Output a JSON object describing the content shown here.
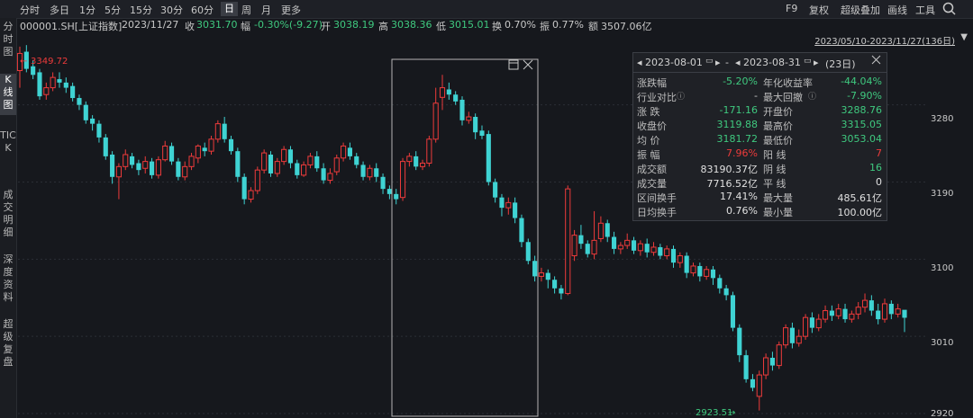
{
  "toolbar": {
    "timeframes": [
      "分时",
      "多日",
      "1分",
      "5分",
      "15分",
      "30分",
      "60分",
      "日",
      "周",
      "月",
      "更多"
    ],
    "active_timeframe": "日",
    "right": [
      "F9",
      "复权",
      "超级叠加",
      "画线",
      "工具"
    ]
  },
  "info": {
    "code": "000001.SH[上证指数]",
    "date": "2023/11/27",
    "close_label": "收",
    "close": "3031.70",
    "change_label": "幅",
    "change": "-0.30%(-9.27)",
    "open_label": "开",
    "open": "3038.19",
    "high_label": "高",
    "high": "3038.36",
    "low_label": "低",
    "low": "3015.01",
    "turnover_label": "换",
    "turnover": "0.70%",
    "amplitude_label": "振",
    "amplitude": "0.77%",
    "amount_label": "额",
    "amount": "3507.06亿"
  },
  "sidebar": {
    "tabs": [
      "分时图",
      "K线图",
      "TICK",
      "成交明细",
      "深度资料",
      "超级复盘"
    ],
    "active": "K线图"
  },
  "chart": {
    "range": "2023/05/10-2023/11/27(136日)",
    "max_label": "3349.72",
    "min_label": "2923.51",
    "y_ticks": [
      "3280",
      "3190",
      "3100",
      "3010",
      "2920"
    ]
  },
  "panel": {
    "start_date": "2023-08-01",
    "end_date": "2023-08-31",
    "days": "(23日)",
    "separator": "-",
    "rows": [
      {
        "l1": "涨跌幅",
        "v1": "-5.20%",
        "c1": "green",
        "l2": "年化收益率",
        "v2": "-44.04%",
        "c2": "green"
      },
      {
        "l1": "行业对比",
        "v1": "-",
        "c1": "gray",
        "l2": "最大回撤",
        "v2": "-7.90%",
        "c2": "green"
      },
      {
        "l1": "涨 跌",
        "v1": "-171.16",
        "c1": "green",
        "l2": "开盘价",
        "v2": "3288.76",
        "c2": "green"
      },
      {
        "l1": "收盘价",
        "v1": "3119.88",
        "c1": "green",
        "l2": "最高价",
        "v2": "3315.05",
        "c2": "green"
      },
      {
        "l1": "均 价",
        "v1": "3181.72",
        "c1": "green",
        "l2": "最低价",
        "v2": "3053.04",
        "c2": "green"
      },
      {
        "l1": "振 幅",
        "v1": "7.96%",
        "c1": "red",
        "l2": "阳 线",
        "v2": "7",
        "c2": "red"
      },
      {
        "l1": "成交额",
        "v1": "83190.37亿",
        "c1": "white",
        "l2": "阴 线",
        "v2": "16",
        "c2": "green"
      },
      {
        "l1": "成交量",
        "v1": "7716.52亿",
        "c1": "white",
        "l2": "平 线",
        "v2": "0",
        "c2": "white"
      },
      {
        "l1": "区间换手",
        "v1": "17.41%",
        "c1": "white",
        "l2": "最大量",
        "v2": "485.61亿",
        "c2": "white"
      },
      {
        "l1": "日均换手",
        "v1": "0.76%",
        "c1": "white",
        "l2": "最小量",
        "v2": "100.00亿",
        "c2": "white"
      }
    ]
  },
  "chart_data": {
    "type": "candlestick",
    "y_ticks": [
      3280,
      3190,
      3100,
      3010,
      2920
    ],
    "ylim": [
      2920,
      3352
    ],
    "max_marker": 3349.72,
    "min_marker": 2923.51,
    "candles": [
      [
        3320,
        3340,
        3300,
        3348
      ],
      [
        3342,
        3322,
        3318,
        3349.72
      ],
      [
        3325,
        3315,
        3310,
        3332
      ],
      [
        3318,
        3290,
        3286,
        3322
      ],
      [
        3292,
        3300,
        3286,
        3306
      ],
      [
        3300,
        3312,
        3296,
        3318
      ],
      [
        3310,
        3306,
        3300,
        3318
      ],
      [
        3306,
        3300,
        3294,
        3312
      ],
      [
        3302,
        3288,
        3284,
        3306
      ],
      [
        3288,
        3280,
        3274,
        3292
      ],
      [
        3280,
        3262,
        3258,
        3284
      ],
      [
        3264,
        3258,
        3250,
        3268
      ],
      [
        3258,
        3242,
        3236,
        3262
      ],
      [
        3242,
        3220,
        3216,
        3246
      ],
      [
        3222,
        3196,
        3188,
        3226
      ],
      [
        3196,
        3208,
        3170,
        3212
      ],
      [
        3208,
        3222,
        3204,
        3228
      ],
      [
        3220,
        3210,
        3206,
        3224
      ],
      [
        3212,
        3204,
        3198,
        3216
      ],
      [
        3206,
        3214,
        3200,
        3220
      ],
      [
        3214,
        3198,
        3194,
        3218
      ],
      [
        3198,
        3216,
        3194,
        3220
      ],
      [
        3216,
        3232,
        3214,
        3238
      ],
      [
        3232,
        3214,
        3210,
        3236
      ],
      [
        3214,
        3196,
        3192,
        3218
      ],
      [
        3196,
        3208,
        3192,
        3214
      ],
      [
        3208,
        3220,
        3204,
        3224
      ],
      [
        3218,
        3232,
        3212,
        3234
      ],
      [
        3230,
        3226,
        3220,
        3236
      ],
      [
        3226,
        3240,
        3222,
        3244
      ],
      [
        3240,
        3258,
        3236,
        3262
      ],
      [
        3258,
        3240,
        3236,
        3266
      ],
      [
        3240,
        3226,
        3222,
        3244
      ],
      [
        3226,
        3196,
        3190,
        3230
      ],
      [
        3196,
        3170,
        3164,
        3200
      ],
      [
        3170,
        3180,
        3166,
        3184
      ],
      [
        3180,
        3204,
        3176,
        3208
      ],
      [
        3204,
        3224,
        3200,
        3228
      ],
      [
        3222,
        3200,
        3196,
        3226
      ],
      [
        3200,
        3214,
        3196,
        3218
      ],
      [
        3214,
        3228,
        3210,
        3232
      ],
      [
        3228,
        3212,
        3206,
        3232
      ],
      [
        3212,
        3198,
        3194,
        3216
      ],
      [
        3198,
        3210,
        3196,
        3214
      ],
      [
        3210,
        3220,
        3206,
        3224
      ],
      [
        3220,
        3206,
        3202,
        3226
      ],
      [
        3206,
        3192,
        3188,
        3212
      ],
      [
        3192,
        3200,
        3188,
        3206
      ],
      [
        3202,
        3218,
        3198,
        3222
      ],
      [
        3218,
        3232,
        3214,
        3236
      ],
      [
        3230,
        3220,
        3216,
        3236
      ],
      [
        3220,
        3210,
        3206,
        3224
      ],
      [
        3210,
        3196,
        3192,
        3214
      ],
      [
        3196,
        3206,
        3192,
        3210
      ],
      [
        3206,
        3196,
        3190,
        3212
      ],
      [
        3196,
        3182,
        3176,
        3200
      ],
      [
        3182,
        3176,
        3170,
        3186
      ],
      [
        3176,
        3170,
        3164,
        3182
      ],
      [
        3172,
        3214,
        3168,
        3218
      ],
      [
        3214,
        3220,
        3208,
        3224
      ],
      [
        3220,
        3208,
        3204,
        3226
      ],
      [
        3208,
        3212,
        3204,
        3216
      ],
      [
        3212,
        3240,
        3208,
        3244
      ],
      [
        3240,
        3282,
        3236,
        3300
      ],
      [
        3288.76,
        3300,
        3274,
        3315.05
      ],
      [
        3298,
        3292,
        3286,
        3306
      ],
      [
        3292,
        3284,
        3280,
        3296
      ],
      [
        3286,
        3262,
        3256,
        3290
      ],
      [
        3262,
        3266,
        3258,
        3272
      ],
      [
        3266,
        3248,
        3240,
        3270
      ],
      [
        3250,
        3244,
        3240,
        3256
      ],
      [
        3246,
        3190,
        3186,
        3250
      ],
      [
        3190,
        3172,
        3166,
        3194
      ],
      [
        3172,
        3160,
        3150,
        3176
      ],
      [
        3160,
        3166,
        3152,
        3172
      ],
      [
        3166,
        3148,
        3142,
        3172
      ],
      [
        3148,
        3120,
        3114,
        3152
      ],
      [
        3120,
        3098,
        3094,
        3124
      ],
      [
        3098,
        3080,
        3074,
        3104
      ],
      [
        3080,
        3084,
        3074,
        3090
      ],
      [
        3084,
        3076,
        3066,
        3088
      ],
      [
        3076,
        3066,
        3060,
        3080
      ],
      [
        3066,
        3060,
        3053.04,
        3070
      ],
      [
        3060,
        3182,
        3058,
        3186
      ],
      [
        3104,
        3128,
        3098,
        3134
      ],
      [
        3128,
        3118,
        3112,
        3140
      ],
      [
        3118,
        3106,
        3102,
        3122
      ],
      [
        3106,
        3122,
        3100,
        3156
      ],
      [
        3124,
        3142,
        3120,
        3150
      ],
      [
        3142,
        3126,
        3120,
        3146
      ],
      [
        3126,
        3112,
        3106,
        3132
      ],
      [
        3112,
        3116,
        3106,
        3120
      ],
      [
        3116,
        3122,
        3112,
        3130
      ],
      [
        3122,
        3110,
        3106,
        3126
      ],
      [
        3110,
        3118,
        3104,
        3122
      ],
      [
        3118,
        3108,
        3102,
        3124
      ],
      [
        3108,
        3114,
        3104,
        3120
      ],
      [
        3114,
        3104,
        3100,
        3118
      ],
      [
        3104,
        3112,
        3100,
        3116
      ],
      [
        3112,
        3096,
        3090,
        3116
      ],
      [
        3096,
        3104,
        3090,
        3108
      ],
      [
        3104,
        3084,
        3078,
        3108
      ],
      [
        3084,
        3092,
        3080,
        3096
      ],
      [
        3092,
        3080,
        3074,
        3096
      ],
      [
        3080,
        3088,
        3076,
        3092
      ],
      [
        3088,
        3078,
        3070,
        3092
      ],
      [
        3078,
        3066,
        3060,
        3082
      ],
      [
        3066,
        3058,
        3052,
        3070
      ],
      [
        3058,
        3020,
        3016,
        3062
      ],
      [
        3020,
        2988,
        2980,
        3024
      ],
      [
        2988,
        2960,
        2956,
        2994
      ],
      [
        2960,
        2950,
        2946,
        2966
      ],
      [
        2940,
        2965,
        2923.51,
        2970
      ],
      [
        2965,
        2985,
        2960,
        2990
      ],
      [
        2985,
        2976,
        2970,
        2992
      ],
      [
        2976,
        3000,
        2972,
        3004
      ],
      [
        3000,
        3020,
        2996,
        3024
      ],
      [
        3020,
        3002,
        2996,
        3026
      ],
      [
        3002,
        3010,
        2998,
        3018
      ],
      [
        3010,
        3032,
        3006,
        3036
      ],
      [
        3032,
        3020,
        3014,
        3038
      ],
      [
        3020,
        3030,
        3016,
        3036
      ],
      [
        3030,
        3040,
        3026,
        3046
      ],
      [
        3040,
        3034,
        3028,
        3046
      ],
      [
        3034,
        3042,
        3030,
        3048
      ],
      [
        3042,
        3030,
        3026,
        3048
      ],
      [
        3030,
        3036,
        3026,
        3040
      ],
      [
        3036,
        3044,
        3030,
        3050
      ],
      [
        3044,
        3052,
        3038,
        3060
      ],
      [
        3052,
        3040,
        3034,
        3058
      ],
      [
        3040,
        3030,
        3024,
        3048
      ],
      [
        3030,
        3048,
        3026,
        3054
      ],
      [
        3048,
        3036,
        3030,
        3052
      ],
      [
        3036,
        3042,
        3032,
        3048
      ],
      [
        3040.97,
        3031.7,
        3015.01,
        3038.36
      ]
    ]
  }
}
